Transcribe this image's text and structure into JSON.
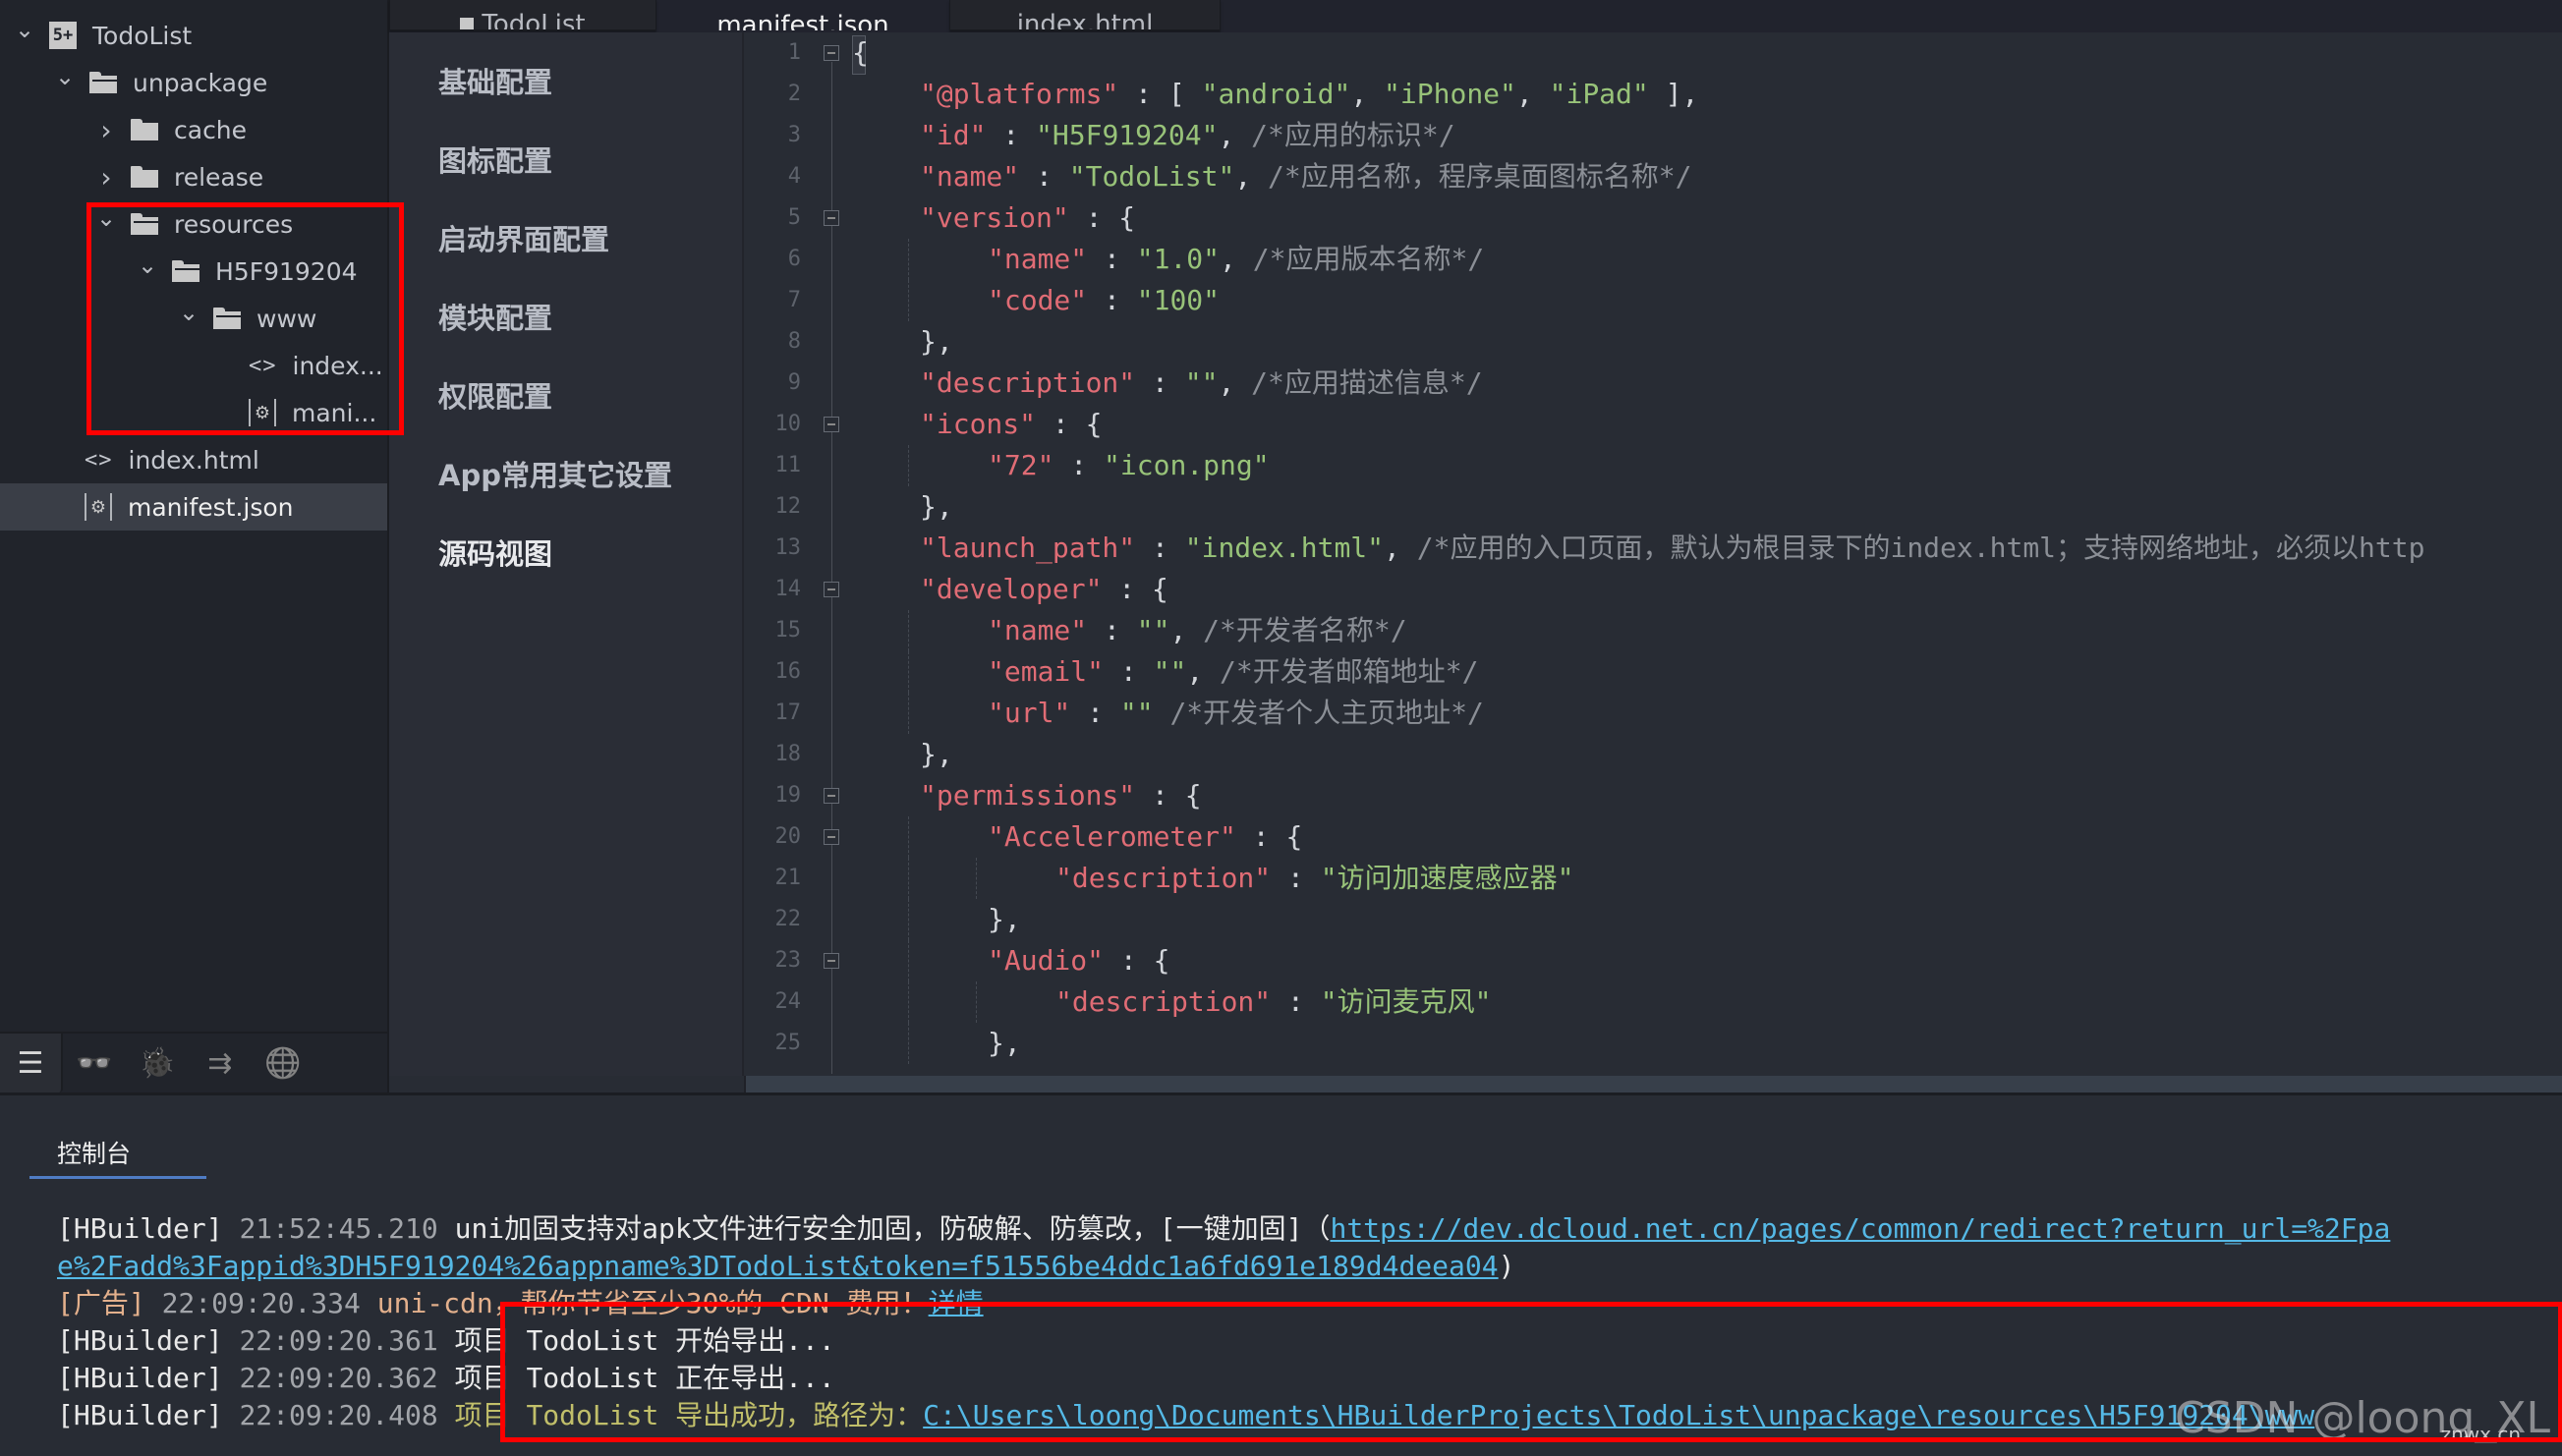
{
  "sidebar": {
    "tree": [
      {
        "label": "TodoList",
        "icon": "project-icon",
        "chevron": "expanded",
        "depth": 0
      },
      {
        "label": "unpackage",
        "icon": "folder-open-icon",
        "chevron": "expanded",
        "depth": 1
      },
      {
        "label": "cache",
        "icon": "folder-icon",
        "chevron": "collapsed",
        "depth": 2
      },
      {
        "label": "release",
        "icon": "folder-icon",
        "chevron": "collapsed",
        "depth": 2
      },
      {
        "label": "resources",
        "icon": "folder-open-icon",
        "chevron": "expanded",
        "depth": 2
      },
      {
        "label": "H5F919204",
        "icon": "folder-open-icon",
        "chevron": "expanded",
        "depth": 3
      },
      {
        "label": "www",
        "icon": "folder-open-icon",
        "chevron": "expanded",
        "depth": 4
      },
      {
        "label": "index...",
        "icon": "html-file-icon",
        "chevron": "none",
        "depth": 5
      },
      {
        "label": "mani...",
        "icon": "manifest-file-icon",
        "chevron": "none",
        "depth": 5
      },
      {
        "label": "index.html",
        "icon": "html-file-icon",
        "chevron": "none",
        "depth": 1
      },
      {
        "label": "manifest.json",
        "icon": "manifest-file-icon",
        "chevron": "none",
        "depth": 1,
        "selected": true
      }
    ],
    "toolbar": [
      {
        "name": "project-manager-icon",
        "glyph": "☰",
        "active": true
      },
      {
        "name": "binoculars-icon",
        "glyph": "👓"
      },
      {
        "name": "bug-icon",
        "glyph": "🐞"
      },
      {
        "name": "export-icon",
        "glyph": "⇉"
      },
      {
        "name": "globe-cloud-icon",
        "glyph": "🌐"
      }
    ]
  },
  "tabs": [
    {
      "label": "TodoList",
      "active": false
    },
    {
      "label": "manifest.json",
      "active": true
    },
    {
      "label": "index.html",
      "active": false
    }
  ],
  "settings_menu": [
    {
      "label": "基础配置"
    },
    {
      "label": "图标配置"
    },
    {
      "label": "启动界面配置"
    },
    {
      "label": "模块配置"
    },
    {
      "label": "权限配置"
    },
    {
      "label": "App常用其它设置"
    },
    {
      "label": "源码视图",
      "active": true
    }
  ],
  "editor": {
    "lines": [
      {
        "n": "1",
        "fold": true,
        "indent": 0,
        "tokens": [
          [
            "p",
            "{"
          ]
        ]
      },
      {
        "n": "2",
        "indent": 1,
        "tokens": [
          [
            "k",
            "\"@platforms\""
          ],
          [
            "p",
            " : [ "
          ],
          [
            "s",
            "\"android\""
          ],
          [
            "p",
            ", "
          ],
          [
            "s",
            "\"iPhone\""
          ],
          [
            "p",
            ", "
          ],
          [
            "s",
            "\"iPad\""
          ],
          [
            "p",
            " ],"
          ]
        ]
      },
      {
        "n": "3",
        "indent": 1,
        "tokens": [
          [
            "k",
            "\"id\""
          ],
          [
            "p",
            " : "
          ],
          [
            "s",
            "\"H5F919204\""
          ],
          [
            "p",
            ", "
          ],
          [
            "c",
            "/*应用的标识*/"
          ]
        ]
      },
      {
        "n": "4",
        "indent": 1,
        "tokens": [
          [
            "k",
            "\"name\""
          ],
          [
            "p",
            " : "
          ],
          [
            "s",
            "\"TodoList\""
          ],
          [
            "p",
            ", "
          ],
          [
            "c",
            "/*应用名称，程序桌面图标名称*/"
          ]
        ]
      },
      {
        "n": "5",
        "fold": true,
        "indent": 1,
        "tokens": [
          [
            "k",
            "\"version\""
          ],
          [
            "p",
            " : {"
          ]
        ]
      },
      {
        "n": "6",
        "indent": 2,
        "tokens": [
          [
            "k",
            "\"name\""
          ],
          [
            "p",
            " : "
          ],
          [
            "s",
            "\"1.0\""
          ],
          [
            "p",
            ", "
          ],
          [
            "c",
            "/*应用版本名称*/"
          ]
        ]
      },
      {
        "n": "7",
        "indent": 2,
        "tokens": [
          [
            "k",
            "\"code\""
          ],
          [
            "p",
            " : "
          ],
          [
            "s",
            "\"100\""
          ]
        ]
      },
      {
        "n": "8",
        "indent": 1,
        "tokens": [
          [
            "p",
            "},"
          ]
        ]
      },
      {
        "n": "9",
        "indent": 1,
        "tokens": [
          [
            "k",
            "\"description\""
          ],
          [
            "p",
            " : "
          ],
          [
            "s",
            "\"\""
          ],
          [
            "p",
            ", "
          ],
          [
            "c",
            "/*应用描述信息*/"
          ]
        ]
      },
      {
        "n": "10",
        "fold": true,
        "indent": 1,
        "tokens": [
          [
            "k",
            "\"icons\""
          ],
          [
            "p",
            " : {"
          ]
        ]
      },
      {
        "n": "11",
        "indent": 2,
        "tokens": [
          [
            "k",
            "\"72\""
          ],
          [
            "p",
            " : "
          ],
          [
            "s",
            "\"icon.png\""
          ]
        ]
      },
      {
        "n": "12",
        "indent": 1,
        "tokens": [
          [
            "p",
            "},"
          ]
        ]
      },
      {
        "n": "13",
        "indent": 1,
        "tokens": [
          [
            "k",
            "\"launch_path\""
          ],
          [
            "p",
            " : "
          ],
          [
            "s",
            "\"index.html\""
          ],
          [
            "p",
            ", "
          ],
          [
            "c",
            "/*应用的入口页面，默认为根目录下的index.html；支持网络地址，必须以http"
          ]
        ]
      },
      {
        "n": "14",
        "fold": true,
        "indent": 1,
        "tokens": [
          [
            "k",
            "\"developer\""
          ],
          [
            "p",
            " : {"
          ]
        ]
      },
      {
        "n": "15",
        "indent": 2,
        "tokens": [
          [
            "k",
            "\"name\""
          ],
          [
            "p",
            " : "
          ],
          [
            "s",
            "\"\""
          ],
          [
            "p",
            ", "
          ],
          [
            "c",
            "/*开发者名称*/"
          ]
        ]
      },
      {
        "n": "16",
        "indent": 2,
        "tokens": [
          [
            "k",
            "\"email\""
          ],
          [
            "p",
            " : "
          ],
          [
            "s",
            "\"\""
          ],
          [
            "p",
            ", "
          ],
          [
            "c",
            "/*开发者邮箱地址*/"
          ]
        ]
      },
      {
        "n": "17",
        "indent": 2,
        "tokens": [
          [
            "k",
            "\"url\""
          ],
          [
            "p",
            " : "
          ],
          [
            "s",
            "\"\""
          ],
          [
            "p",
            " "
          ],
          [
            "c",
            "/*开发者个人主页地址*/"
          ]
        ]
      },
      {
        "n": "18",
        "indent": 1,
        "tokens": [
          [
            "p",
            "},"
          ]
        ]
      },
      {
        "n": "19",
        "fold": true,
        "indent": 1,
        "tokens": [
          [
            "k",
            "\"permissions\""
          ],
          [
            "p",
            " : {"
          ]
        ]
      },
      {
        "n": "20",
        "fold": true,
        "indent": 2,
        "tokens": [
          [
            "k",
            "\"Accelerometer\""
          ],
          [
            "p",
            " : {"
          ]
        ]
      },
      {
        "n": "21",
        "indent": 3,
        "tokens": [
          [
            "k",
            "\"description\""
          ],
          [
            "p",
            " : "
          ],
          [
            "s",
            "\"访问加速度感应器\""
          ]
        ]
      },
      {
        "n": "22",
        "indent": 2,
        "tokens": [
          [
            "p",
            "},"
          ]
        ]
      },
      {
        "n": "23",
        "fold": true,
        "indent": 2,
        "tokens": [
          [
            "k",
            "\"Audio\""
          ],
          [
            "p",
            " : {"
          ]
        ]
      },
      {
        "n": "24",
        "indent": 3,
        "tokens": [
          [
            "k",
            "\"description\""
          ],
          [
            "p",
            " : "
          ],
          [
            "s",
            "\"访问麦克风\""
          ]
        ]
      },
      {
        "n": "25",
        "indent": 2,
        "tokens": [
          [
            "p",
            "},"
          ]
        ]
      }
    ]
  },
  "console": {
    "tab_label": "控制台",
    "lines": [
      {
        "tokens": [
          [
            "tag",
            "[HBuilder] "
          ],
          [
            "time",
            "21:52:45.210 "
          ],
          [
            "msg",
            "uni加固支持对apk文件进行安全加固，防破解、防篡改，[一键加固]（"
          ],
          [
            "link",
            "https://dev.dcloud.net.cn/pages/common/redirect?return_url=%2Fpa"
          ]
        ]
      },
      {
        "tokens": [
          [
            "link",
            "e%2Fadd%3Fappid%3DH5F919204%26appname%3DTodoList&token=f51556be4ddc1a6fd691e189d4deea04"
          ],
          [
            "msg",
            ")"
          ]
        ]
      },
      {
        "tokens": [
          [
            "ad",
            "[广告] "
          ],
          [
            "time",
            "22:09:20.334 "
          ],
          [
            "ad",
            "uni-cdn，帮你节省至少30%的 CDN 费用！"
          ],
          [
            "link",
            "详情"
          ]
        ]
      },
      {
        "tokens": [
          [
            "tag",
            "[HBuilder] "
          ],
          [
            "time",
            "22:09:20.361 "
          ],
          [
            "msg",
            "项目 TodoList 开始导出..."
          ]
        ]
      },
      {
        "tokens": [
          [
            "tag",
            "[HBuilder] "
          ],
          [
            "time",
            "22:09:20.362 "
          ],
          [
            "msg",
            "项目 TodoList 正在导出..."
          ]
        ]
      },
      {
        "tokens": [
          [
            "tag",
            "[HBuilder] "
          ],
          [
            "time",
            "22:09:20.408 "
          ],
          [
            "ok",
            "项目 TodoList 导出成功，路径为："
          ],
          [
            "link",
            "C:\\Users\\loong\\Documents\\HBuilderProjects\\TodoList\\unpackage\\resources\\H5F919204\\www"
          ]
        ]
      }
    ]
  },
  "watermark": {
    "text": "CSDN @loong_XL",
    "sub": "znwx.cn"
  },
  "colors": {
    "key": "#e06c75",
    "string": "#98c379",
    "comment": "#8b8f96",
    "link": "#55b9e6",
    "success": "#c1bf6a",
    "ad": "#e3b08c",
    "annotation": "#ff0000",
    "console_tab_accent": "#4f7cc4"
  }
}
